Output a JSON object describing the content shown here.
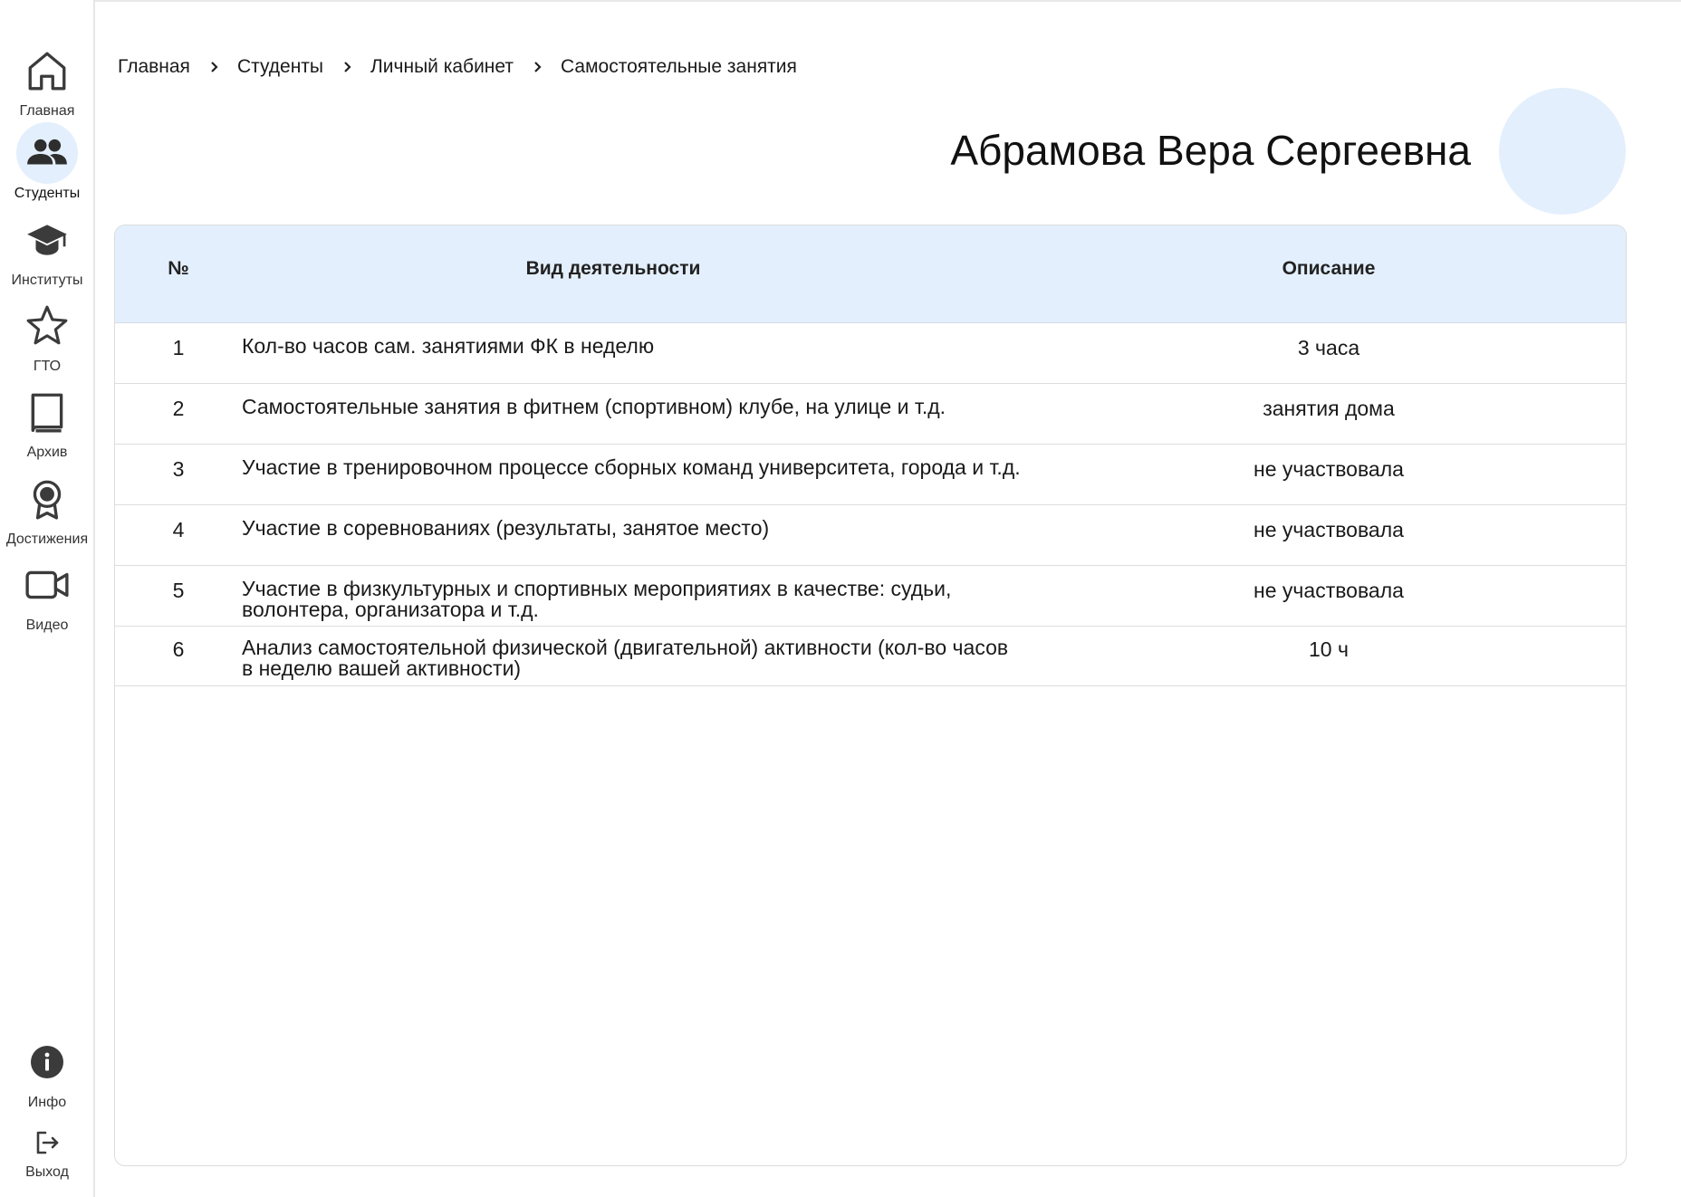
{
  "sidebar": {
    "items": [
      {
        "label": "Главная",
        "icon": "home-icon"
      },
      {
        "label": "Студенты",
        "icon": "people-icon"
      },
      {
        "label": "Институты",
        "icon": "graduation-cap-icon"
      },
      {
        "label": "ГТО",
        "icon": "star-icon"
      },
      {
        "label": "Архив",
        "icon": "book-icon"
      },
      {
        "label": "Достижения",
        "icon": "award-icon"
      },
      {
        "label": "Видео",
        "icon": "video-camera-icon"
      },
      {
        "label": "Инфо",
        "icon": "info-icon"
      },
      {
        "label": "Выход",
        "icon": "logout-icon"
      }
    ],
    "active_index": 1
  },
  "breadcrumb": [
    "Главная",
    "Студенты",
    "Личный кабинет",
    "Самостоятельные занятия"
  ],
  "student": {
    "name": "Абрамова Вера Сергеевна"
  },
  "table": {
    "columns": [
      "№",
      "Вид деятельности",
      "Описание"
    ],
    "rows": [
      {
        "num": "1",
        "activity": "Кол-во часов сам. занятиями ФК в неделю",
        "description": "3 часа"
      },
      {
        "num": "2",
        "activity": "Самостоятельные занятия в фитнем (спортивном) клубе, на улице и т.д.",
        "description": "занятия дома"
      },
      {
        "num": "3",
        "activity": "Участие в тренировочном процессе сборных команд университета, города и т.д.",
        "description": "не участвовала"
      },
      {
        "num": "4",
        "activity": "Участие в соревнованиях (результаты, занятое место)",
        "description": "не участвовала"
      },
      {
        "num": "5",
        "activity": "Участие в физкультурных и спортивных мероприятиях в качестве: судьи, волонтера, организатора и т.д.",
        "description": "не участвовала"
      },
      {
        "num": "6",
        "activity": "Анализ самостоятельной физической (двигательной) активности (кол-во часов в неделю вашей активности)",
        "description": "10 ч"
      }
    ]
  },
  "colors": {
    "accent_light": "#e3effc",
    "icon": "#3b3b3b"
  }
}
